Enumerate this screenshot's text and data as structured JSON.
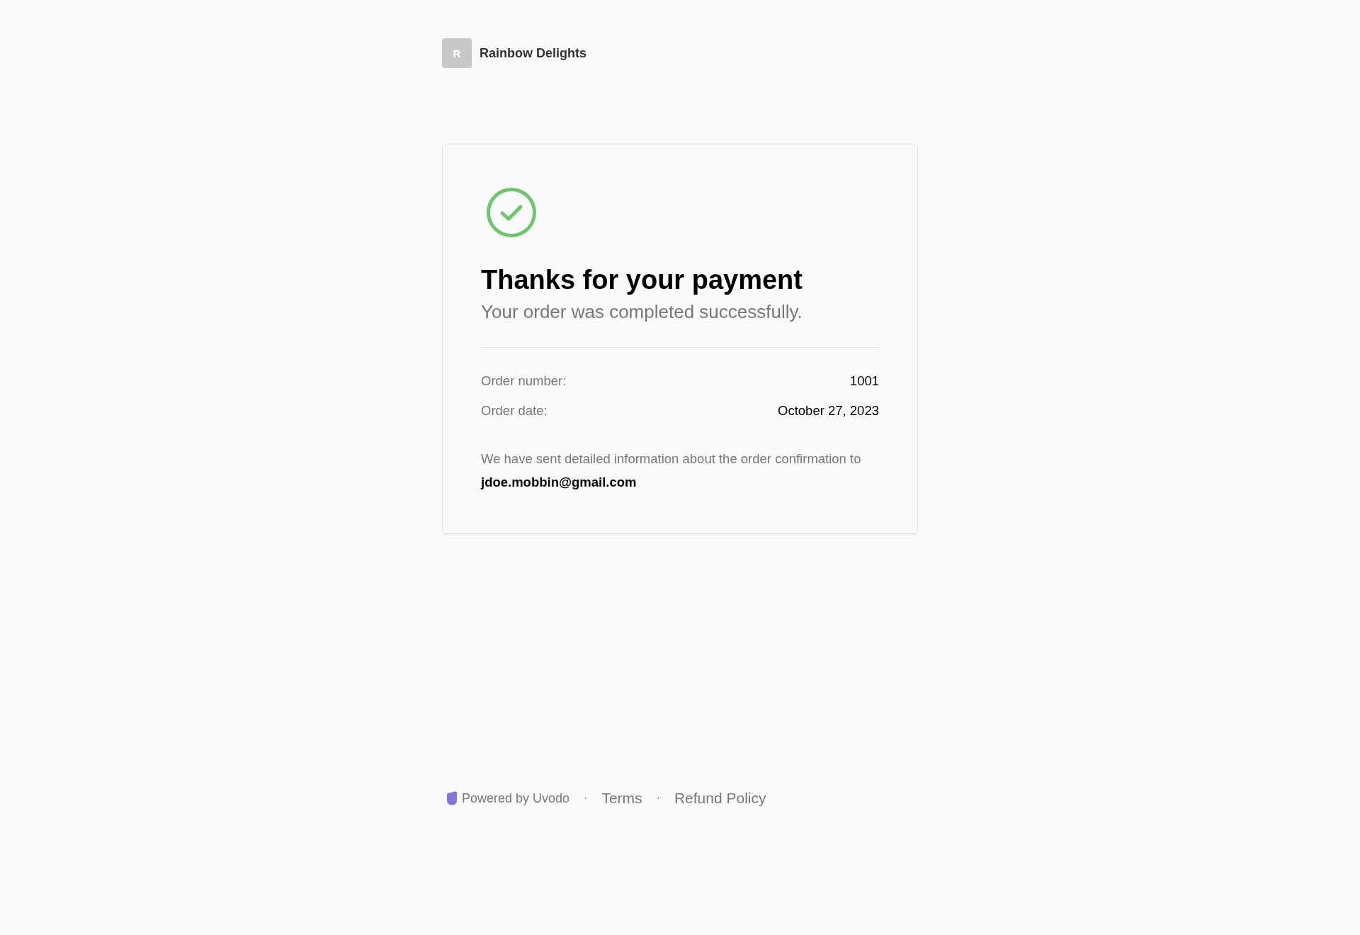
{
  "store": {
    "initial": "R",
    "name": "Rainbow Delights"
  },
  "confirmation": {
    "title": "Thanks for your payment",
    "subtitle": "Your order was completed successfully.",
    "details": [
      {
        "label": "Order number:",
        "value": "1001"
      },
      {
        "label": "Order date:",
        "value": "October 27, 2023"
      }
    ],
    "message": "We have sent detailed information about the order confirmation to **jdoe.mobbin@gmail.com**"
  },
  "footer": {
    "powered_by": "Powered by Uvodo",
    "separators": [
      "·",
      "·"
    ],
    "links": [
      "Terms",
      "Refund Policy"
    ]
  }
}
